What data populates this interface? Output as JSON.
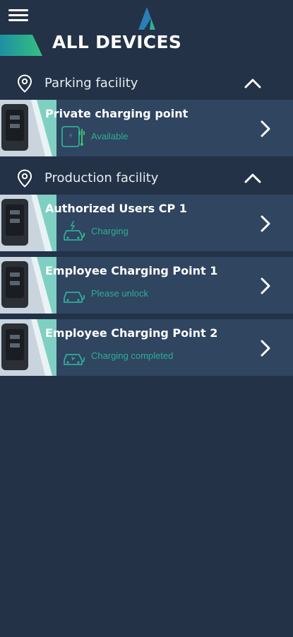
{
  "header": {
    "title": "ALL DEVICES",
    "menu_icon": "hamburger-menu-icon",
    "logo": "app-logo"
  },
  "colors": {
    "background": "#233246",
    "card": "#2f4560",
    "accent_teal": "#2fae98",
    "logo_blue": "#2a7fb6"
  },
  "groups": [
    {
      "label": "Parking facility",
      "icon": "location-pin-icon",
      "toggle_icon": "chevron-up-icon",
      "devices": [
        {
          "name": "Private charging point",
          "status": "Available",
          "status_icon": "plug-available-icon"
        }
      ]
    },
    {
      "label": "Production facility",
      "icon": "location-pin-icon",
      "toggle_icon": "chevron-up-icon",
      "devices": [
        {
          "name": "Authorized Users CP 1",
          "status": "Charging",
          "status_icon": "car-charging-icon"
        },
        {
          "name": "Employee Charging Point 1",
          "status": "Please unlock",
          "status_icon": "car-icon"
        },
        {
          "name": "Employee Charging Point 2",
          "status": "Charging completed",
          "status_icon": "car-charged-icon"
        }
      ]
    }
  ]
}
